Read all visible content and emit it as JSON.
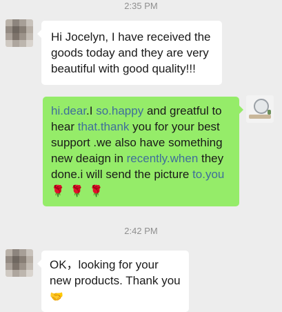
{
  "chat": {
    "timestamps": [
      "2:35 PM",
      "2:42 PM"
    ],
    "messages": [
      {
        "direction": "incoming",
        "text": "Hi Jocelyn, I have received the goods today and they are very beautiful with good quality!!!"
      },
      {
        "direction": "outgoing",
        "segments": [
          {
            "text": "hi.dear",
            "link": true
          },
          {
            "text": ".I ",
            "link": false
          },
          {
            "text": "so.happy",
            "link": true
          },
          {
            "text": " and greatful to hear ",
            "link": false
          },
          {
            "text": "that.thank",
            "link": true
          },
          {
            "text": " you for your best support .we also have something new deaign in ",
            "link": false
          },
          {
            "text": "recently.when",
            "link": true
          },
          {
            "text": " they done.i will send the picture ",
            "link": false
          },
          {
            "text": "to.you",
            "link": true
          }
        ],
        "emoji": [
          "rose-emoji",
          "rose-emoji",
          "rose-emoji"
        ]
      },
      {
        "direction": "incoming",
        "text": "OK，looking for your new products. Thank you",
        "emoji": [
          "handshake-emoji"
        ]
      }
    ]
  },
  "colors": {
    "background": "#ededed",
    "incoming_bubble": "#ffffff",
    "outgoing_bubble": "#95ec69",
    "link": "#3f6e9a",
    "timestamp": "#8f8f8f"
  }
}
